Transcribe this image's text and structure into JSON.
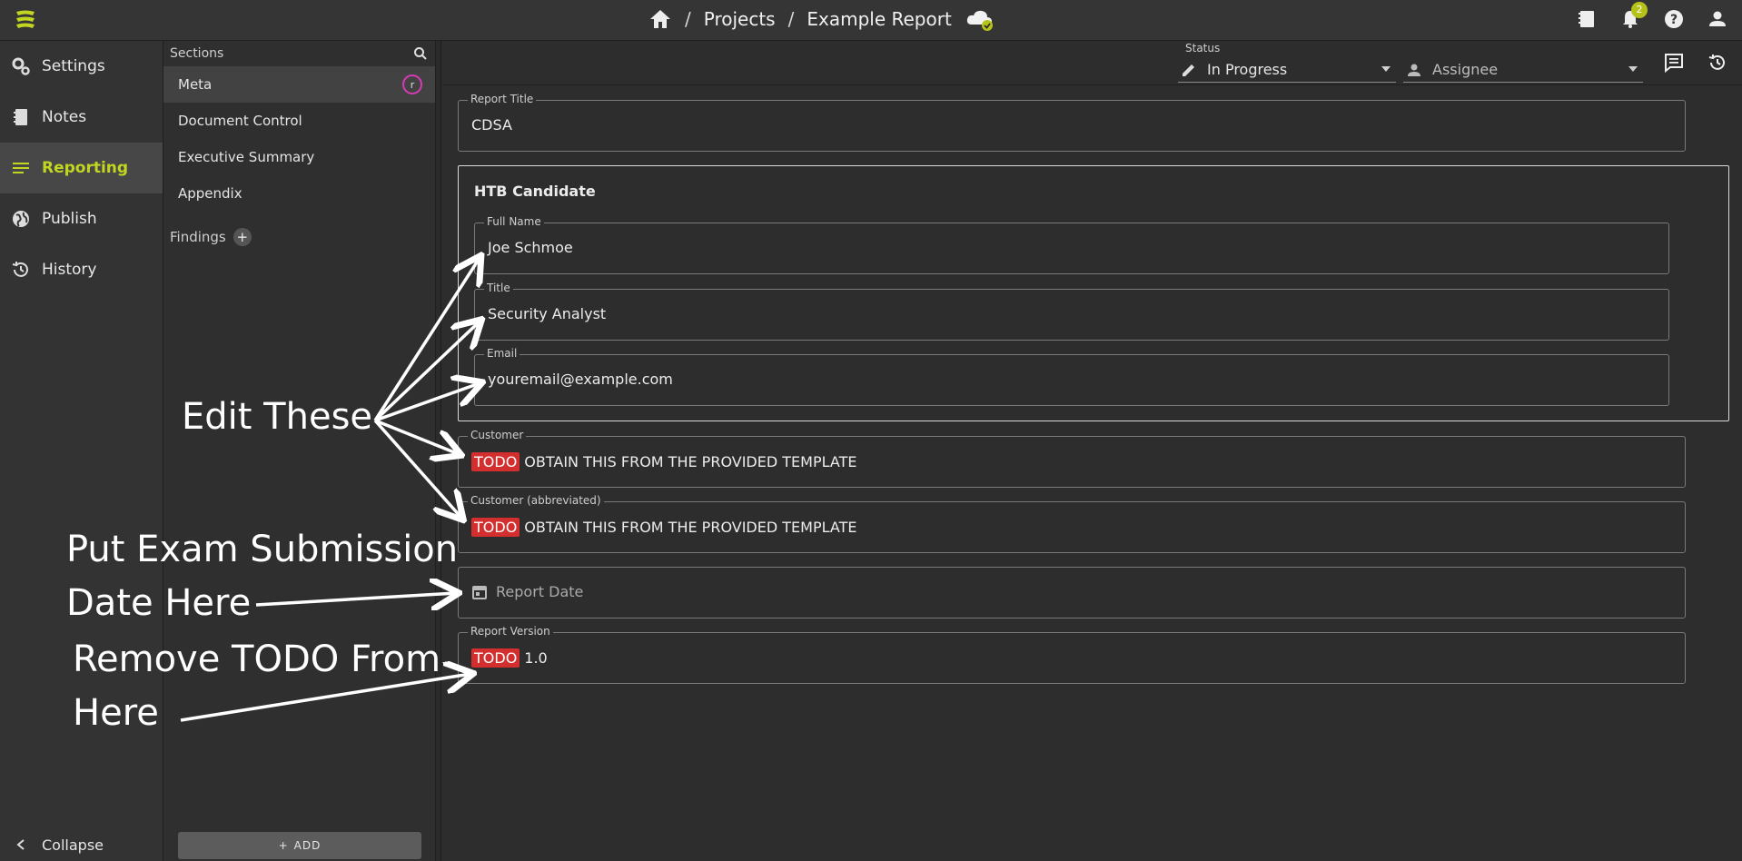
{
  "topbar": {
    "breadcrumb": [
      "Projects",
      "Example Report"
    ],
    "notification_count": "2"
  },
  "leftnav": {
    "items": [
      {
        "label": "Settings",
        "icon": "gears-icon"
      },
      {
        "label": "Notes",
        "icon": "notebook-icon"
      },
      {
        "label": "Reporting",
        "icon": "lines-icon",
        "active": true
      },
      {
        "label": "Publish",
        "icon": "globe-icon"
      },
      {
        "label": "History",
        "icon": "history-icon"
      }
    ],
    "collapse_label": "Collapse"
  },
  "sections": {
    "title": "Sections",
    "items": [
      "Meta",
      "Document Control",
      "Executive Summary",
      "Appendix"
    ],
    "meta_avatar": "r",
    "findings_label": "Findings",
    "add_label": "ADD"
  },
  "header": {
    "status_label": "Status",
    "status_value": "In Progress",
    "assignee_placeholder": "Assignee"
  },
  "form": {
    "report_title_label": "Report Title",
    "report_title_value": "CDSA",
    "group_title": "HTB Candidate",
    "full_name_label": "Full Name",
    "full_name_value": "Joe Schmoe",
    "title_label": "Title",
    "title_value": "Security Analyst",
    "email_label": "Email",
    "email_value": "youremail@example.com",
    "customer_label": "Customer",
    "customer_todo": "TODO",
    "customer_value": "OBTAIN THIS FROM THE PROVIDED TEMPLATE",
    "customer_abbr_label": "Customer (abbreviated)",
    "customer_abbr_todo": "TODO",
    "customer_abbr_value": "OBTAIN THIS FROM THE PROVIDED TEMPLATE",
    "report_date_placeholder": "Report Date",
    "report_version_label": "Report Version",
    "report_version_todo": "TODO",
    "report_version_value": "1.0"
  },
  "annotations": {
    "edit_these": "Edit These",
    "date_line1": "Put Exam Submission",
    "date_line2": "Date Here",
    "todo_line1": "Remove TODO From",
    "todo_line2": "Here"
  },
  "colors": {
    "accent": "#c1d521",
    "todo_red": "#d32f2f",
    "avatar_ring": "#d63bb5"
  }
}
